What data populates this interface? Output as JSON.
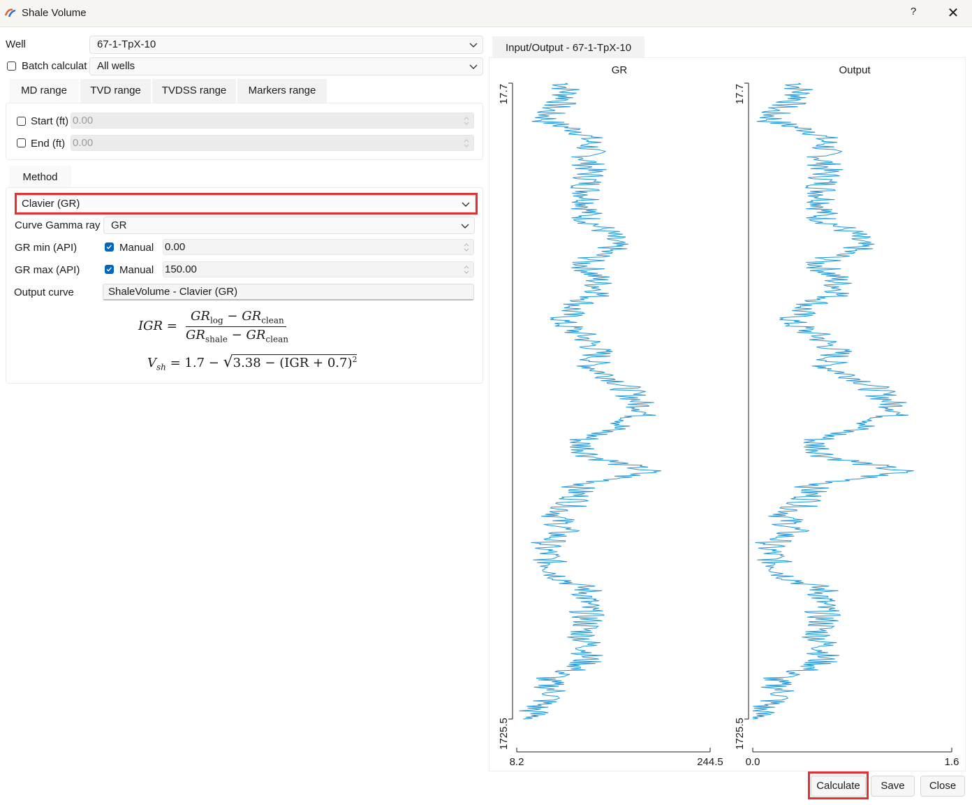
{
  "window": {
    "title": "Shale Volume",
    "help_label": "?",
    "close_label": "✕"
  },
  "well": {
    "label": "Well",
    "value": "67-1-TpX-10"
  },
  "batch": {
    "label": "Batch calculat",
    "checked": false,
    "value": "All wells"
  },
  "range_tabs": [
    {
      "label": "MD range",
      "active": true
    },
    {
      "label": "TVD range",
      "active": false
    },
    {
      "label": "TVDSS range",
      "active": false
    },
    {
      "label": "Markers range",
      "active": false
    }
  ],
  "range": {
    "start": {
      "label": "Start (ft)",
      "checked": false,
      "value": "0.00"
    },
    "end": {
      "label": "End (ft)",
      "checked": false,
      "value": "0.00"
    }
  },
  "method": {
    "tab_label": "Method",
    "selected": "Clavier (GR)",
    "curve_label": "Curve Gamma ray",
    "curve_value": "GR",
    "grmin": {
      "label": "GR min (API)",
      "manual_label": "Manual",
      "checked": true,
      "value": "0.00"
    },
    "grmax": {
      "label": "GR max (API)",
      "manual_label": "Manual",
      "checked": true,
      "value": "150.00"
    },
    "output": {
      "label": "Output curve",
      "value": "ShaleVolume - Clavier (GR)"
    }
  },
  "formula": {
    "igr_lhs": "IGR =",
    "igr_num_a": "GR",
    "igr_num_a_sub": "log",
    "igr_num_b": "GR",
    "igr_num_b_sub": "clean",
    "igr_den_a": "GR",
    "igr_den_a_sub": "shale",
    "igr_den_b": "GR",
    "igr_den_b_sub": "clean",
    "minus": "−",
    "vsh_v": "V",
    "vsh_sub": "sh",
    "vsh_rhs": "= 1.7 −",
    "vsh_root": "3.38 − (IGR + 0.7)",
    "vsh_exp": "2"
  },
  "chart_tab": {
    "label": "Input/Output - 67-1-TpX-10"
  },
  "tracks": [
    {
      "title": "GR",
      "depth_top": "17.7",
      "depth_bottom": "1725.5",
      "x_min": "8.2",
      "x_max": "244.5",
      "color": "#1f96d9"
    },
    {
      "title": "Output",
      "depth_top": "17.7",
      "depth_bottom": "1725.5",
      "x_min": "0.0",
      "x_max": "1.6",
      "color": "#1f96d9"
    }
  ],
  "chart_data": {
    "type": "line",
    "orientation": "vertical-depth",
    "ylim": [
      17.7,
      1725.5
    ],
    "series": [
      {
        "name": "GR",
        "xlim": [
          8.2,
          244.5
        ],
        "depth": [
          17.7,
          60,
          90,
          120,
          150,
          180,
          220,
          260,
          300,
          340,
          380,
          420,
          460,
          500,
          540,
          580,
          620,
          660,
          700,
          740,
          780,
          820,
          860,
          900,
          940,
          980,
          1020,
          1060,
          1100,
          1140,
          1180,
          1220,
          1260,
          1300,
          1340,
          1380,
          1420,
          1460,
          1500,
          1540,
          1580,
          1620,
          1660,
          1700,
          1725.5
        ],
        "values": [
          68,
          70,
          48,
          44,
          90,
          98,
          95,
          98,
          94,
          97,
          93,
          120,
          125,
          90,
          105,
          112,
          78,
          62,
          92,
          108,
          100,
          135,
          150,
          168,
          132,
          84,
          100,
          170,
          84,
          80,
          58,
          65,
          42,
          48,
          58,
          95,
          92,
          95,
          90,
          97,
          90,
          44,
          55,
          28,
          30
        ]
      },
      {
        "name": "Output",
        "xlim": [
          0.0,
          1.6
        ],
        "depth": [
          17.7,
          60,
          90,
          120,
          150,
          180,
          220,
          260,
          300,
          340,
          380,
          420,
          460,
          500,
          540,
          580,
          620,
          660,
          700,
          740,
          780,
          820,
          860,
          900,
          940,
          980,
          1020,
          1060,
          1100,
          1140,
          1180,
          1220,
          1260,
          1300,
          1340,
          1380,
          1420,
          1460,
          1500,
          1540,
          1580,
          1620,
          1660,
          1700,
          1725.5
        ],
        "values": [
          0.37,
          0.38,
          0.17,
          0.15,
          0.52,
          0.59,
          0.57,
          0.59,
          0.56,
          0.58,
          0.55,
          0.8,
          0.85,
          0.52,
          0.66,
          0.72,
          0.42,
          0.3,
          0.54,
          0.68,
          0.6,
          0.92,
          1.05,
          1.2,
          0.88,
          0.48,
          0.6,
          1.2,
          0.48,
          0.44,
          0.26,
          0.32,
          0.12,
          0.17,
          0.26,
          0.57,
          0.55,
          0.57,
          0.53,
          0.59,
          0.53,
          0.16,
          0.25,
          0.05,
          0.06
        ]
      }
    ]
  }
}
